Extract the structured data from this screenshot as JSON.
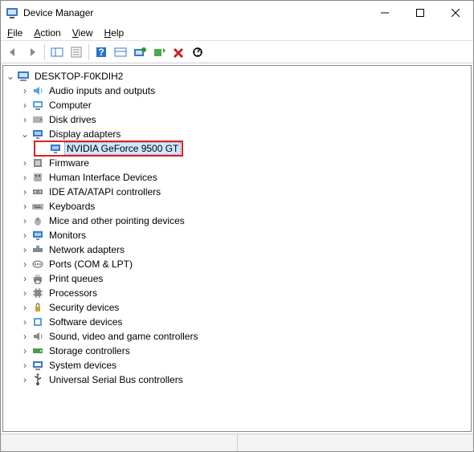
{
  "window": {
    "title": "Device Manager"
  },
  "menus": {
    "file": "File",
    "action": "Action",
    "view": "View",
    "help": "Help"
  },
  "toolbar_icons": {
    "back": "back-icon",
    "forward": "forward-icon",
    "show_hide": "show-hide-icon",
    "properties": "properties-icon",
    "help": "help-icon",
    "console_tree": "console-tree-icon",
    "monitor": "monitor-icon",
    "add": "add-icon",
    "delete": "delete-icon",
    "scan": "scan-icon"
  },
  "tree": {
    "root": "DESKTOP-F0KDIH2",
    "items": [
      {
        "label": "Audio inputs and outputs",
        "expanded": false,
        "icon": "audio"
      },
      {
        "label": "Computer",
        "expanded": false,
        "icon": "computer"
      },
      {
        "label": "Disk drives",
        "expanded": false,
        "icon": "disk"
      },
      {
        "label": "Display adapters",
        "expanded": true,
        "icon": "display",
        "children": [
          {
            "label": "NVIDIA GeForce 9500 GT",
            "icon": "gpu",
            "selected": true,
            "highlight": true
          }
        ]
      },
      {
        "label": "Firmware",
        "expanded": false,
        "icon": "firmware"
      },
      {
        "label": "Human Interface Devices",
        "expanded": false,
        "icon": "hid"
      },
      {
        "label": "IDE ATA/ATAPI controllers",
        "expanded": false,
        "icon": "ide"
      },
      {
        "label": "Keyboards",
        "expanded": false,
        "icon": "keyboard"
      },
      {
        "label": "Mice and other pointing devices",
        "expanded": false,
        "icon": "mouse"
      },
      {
        "label": "Monitors",
        "expanded": false,
        "icon": "monitor"
      },
      {
        "label": "Network adapters",
        "expanded": false,
        "icon": "network"
      },
      {
        "label": "Ports (COM & LPT)",
        "expanded": false,
        "icon": "ports"
      },
      {
        "label": "Print queues",
        "expanded": false,
        "icon": "print"
      },
      {
        "label": "Processors",
        "expanded": false,
        "icon": "processor"
      },
      {
        "label": "Security devices",
        "expanded": false,
        "icon": "security"
      },
      {
        "label": "Software devices",
        "expanded": false,
        "icon": "software"
      },
      {
        "label": "Sound, video and game controllers",
        "expanded": false,
        "icon": "sound"
      },
      {
        "label": "Storage controllers",
        "expanded": false,
        "icon": "storage"
      },
      {
        "label": "System devices",
        "expanded": false,
        "icon": "system"
      },
      {
        "label": "Universal Serial Bus controllers",
        "expanded": false,
        "icon": "usb"
      }
    ]
  }
}
